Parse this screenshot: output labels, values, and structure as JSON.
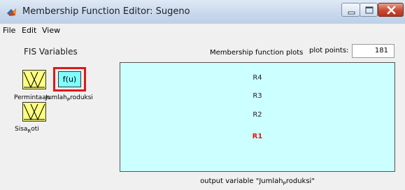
{
  "window": {
    "title": "Membership Function Editor: Sugeno",
    "icon": "matlab-icon",
    "controls": [
      "minimize-icon",
      "maximize-icon",
      "close-icon"
    ]
  },
  "menu": {
    "file": "File",
    "edit": "Edit",
    "view": "View"
  },
  "fis": {
    "heading": "FIS Variables",
    "inputs": [
      {
        "name_main": "Permintaan"
      },
      {
        "name_main": "Sisa",
        "name_sub": "R",
        "name_tail": "oti"
      }
    ],
    "output": {
      "box_label": "f(u)",
      "name_main": "Jumlah",
      "name_sub": "P",
      "name_tail": "roduksi"
    }
  },
  "plots": {
    "title": "Membership function plots",
    "points_label": "plot points:",
    "points_value": "181",
    "membership_functions": [
      "R4",
      "R3",
      "R2",
      "R1"
    ],
    "selected": "R1",
    "footer_prefix": "output variable \"Jumlah",
    "footer_sub": "P",
    "footer_suffix": "roduksi\""
  },
  "colors": {
    "input_box": "#ffff80",
    "output_box": "#80ffff",
    "plot_background": "#ccffff",
    "highlight": "#e01818"
  }
}
